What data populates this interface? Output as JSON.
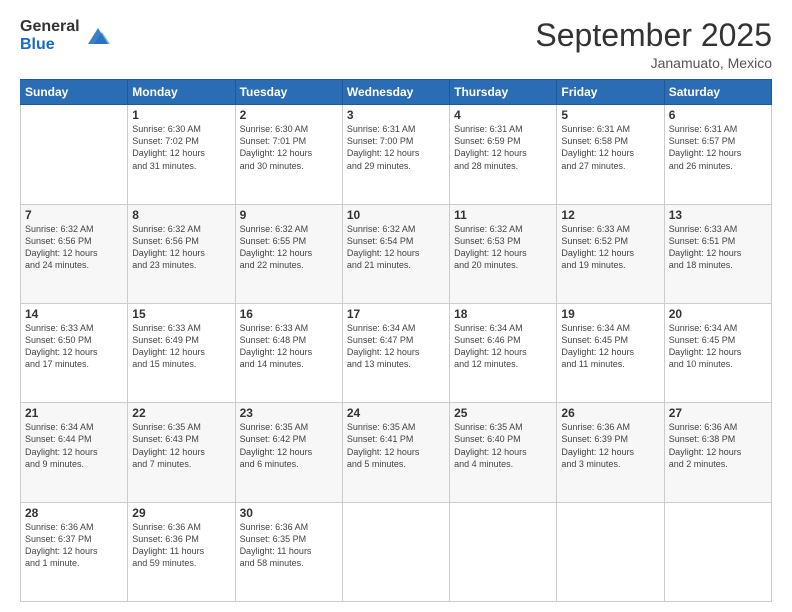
{
  "header": {
    "logo_general": "General",
    "logo_blue": "Blue",
    "month_title": "September 2025",
    "location": "Janamuato, Mexico"
  },
  "days_of_week": [
    "Sunday",
    "Monday",
    "Tuesday",
    "Wednesday",
    "Thursday",
    "Friday",
    "Saturday"
  ],
  "weeks": [
    [
      {
        "day": "",
        "info": ""
      },
      {
        "day": "1",
        "info": "Sunrise: 6:30 AM\nSunset: 7:02 PM\nDaylight: 12 hours\nand 31 minutes."
      },
      {
        "day": "2",
        "info": "Sunrise: 6:30 AM\nSunset: 7:01 PM\nDaylight: 12 hours\nand 30 minutes."
      },
      {
        "day": "3",
        "info": "Sunrise: 6:31 AM\nSunset: 7:00 PM\nDaylight: 12 hours\nand 29 minutes."
      },
      {
        "day": "4",
        "info": "Sunrise: 6:31 AM\nSunset: 6:59 PM\nDaylight: 12 hours\nand 28 minutes."
      },
      {
        "day": "5",
        "info": "Sunrise: 6:31 AM\nSunset: 6:58 PM\nDaylight: 12 hours\nand 27 minutes."
      },
      {
        "day": "6",
        "info": "Sunrise: 6:31 AM\nSunset: 6:57 PM\nDaylight: 12 hours\nand 26 minutes."
      }
    ],
    [
      {
        "day": "7",
        "info": "Sunrise: 6:32 AM\nSunset: 6:56 PM\nDaylight: 12 hours\nand 24 minutes."
      },
      {
        "day": "8",
        "info": "Sunrise: 6:32 AM\nSunset: 6:56 PM\nDaylight: 12 hours\nand 23 minutes."
      },
      {
        "day": "9",
        "info": "Sunrise: 6:32 AM\nSunset: 6:55 PM\nDaylight: 12 hours\nand 22 minutes."
      },
      {
        "day": "10",
        "info": "Sunrise: 6:32 AM\nSunset: 6:54 PM\nDaylight: 12 hours\nand 21 minutes."
      },
      {
        "day": "11",
        "info": "Sunrise: 6:32 AM\nSunset: 6:53 PM\nDaylight: 12 hours\nand 20 minutes."
      },
      {
        "day": "12",
        "info": "Sunrise: 6:33 AM\nSunset: 6:52 PM\nDaylight: 12 hours\nand 19 minutes."
      },
      {
        "day": "13",
        "info": "Sunrise: 6:33 AM\nSunset: 6:51 PM\nDaylight: 12 hours\nand 18 minutes."
      }
    ],
    [
      {
        "day": "14",
        "info": "Sunrise: 6:33 AM\nSunset: 6:50 PM\nDaylight: 12 hours\nand 17 minutes."
      },
      {
        "day": "15",
        "info": "Sunrise: 6:33 AM\nSunset: 6:49 PM\nDaylight: 12 hours\nand 15 minutes."
      },
      {
        "day": "16",
        "info": "Sunrise: 6:33 AM\nSunset: 6:48 PM\nDaylight: 12 hours\nand 14 minutes."
      },
      {
        "day": "17",
        "info": "Sunrise: 6:34 AM\nSunset: 6:47 PM\nDaylight: 12 hours\nand 13 minutes."
      },
      {
        "day": "18",
        "info": "Sunrise: 6:34 AM\nSunset: 6:46 PM\nDaylight: 12 hours\nand 12 minutes."
      },
      {
        "day": "19",
        "info": "Sunrise: 6:34 AM\nSunset: 6:45 PM\nDaylight: 12 hours\nand 11 minutes."
      },
      {
        "day": "20",
        "info": "Sunrise: 6:34 AM\nSunset: 6:45 PM\nDaylight: 12 hours\nand 10 minutes."
      }
    ],
    [
      {
        "day": "21",
        "info": "Sunrise: 6:34 AM\nSunset: 6:44 PM\nDaylight: 12 hours\nand 9 minutes."
      },
      {
        "day": "22",
        "info": "Sunrise: 6:35 AM\nSunset: 6:43 PM\nDaylight: 12 hours\nand 7 minutes."
      },
      {
        "day": "23",
        "info": "Sunrise: 6:35 AM\nSunset: 6:42 PM\nDaylight: 12 hours\nand 6 minutes."
      },
      {
        "day": "24",
        "info": "Sunrise: 6:35 AM\nSunset: 6:41 PM\nDaylight: 12 hours\nand 5 minutes."
      },
      {
        "day": "25",
        "info": "Sunrise: 6:35 AM\nSunset: 6:40 PM\nDaylight: 12 hours\nand 4 minutes."
      },
      {
        "day": "26",
        "info": "Sunrise: 6:36 AM\nSunset: 6:39 PM\nDaylight: 12 hours\nand 3 minutes."
      },
      {
        "day": "27",
        "info": "Sunrise: 6:36 AM\nSunset: 6:38 PM\nDaylight: 12 hours\nand 2 minutes."
      }
    ],
    [
      {
        "day": "28",
        "info": "Sunrise: 6:36 AM\nSunset: 6:37 PM\nDaylight: 12 hours\nand 1 minute."
      },
      {
        "day": "29",
        "info": "Sunrise: 6:36 AM\nSunset: 6:36 PM\nDaylight: 11 hours\nand 59 minutes."
      },
      {
        "day": "30",
        "info": "Sunrise: 6:36 AM\nSunset: 6:35 PM\nDaylight: 11 hours\nand 58 minutes."
      },
      {
        "day": "",
        "info": ""
      },
      {
        "day": "",
        "info": ""
      },
      {
        "day": "",
        "info": ""
      },
      {
        "day": "",
        "info": ""
      }
    ]
  ]
}
